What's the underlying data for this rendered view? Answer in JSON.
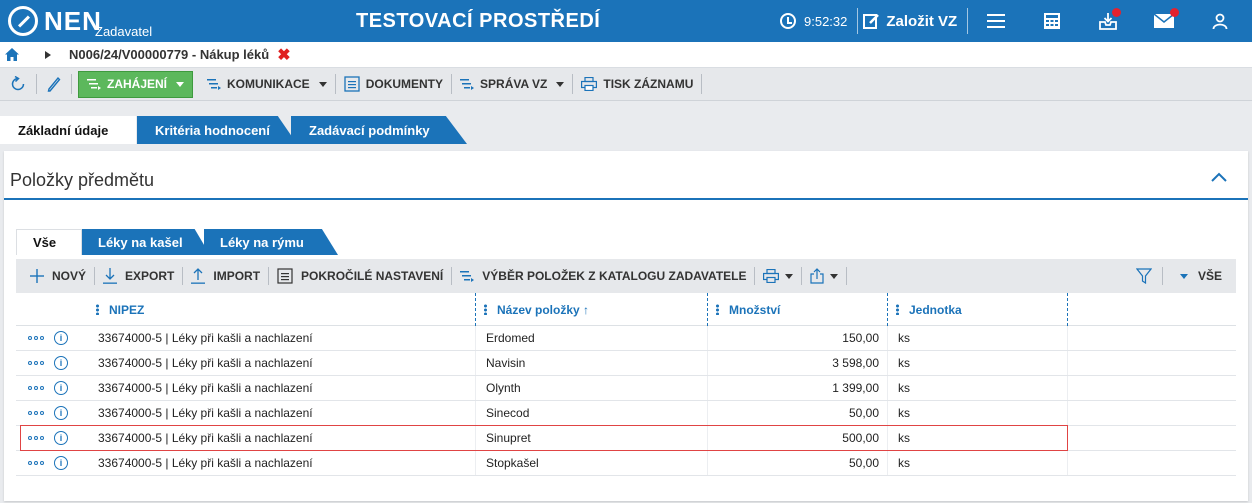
{
  "header": {
    "logo_text": "NEN",
    "logo_sub": "Zadavatel",
    "title": "TESTOVACÍ PROSTŘEDÍ",
    "time": "9:52:32",
    "create_label": "Založit VZ",
    "accent_color": "#1b73b9",
    "icons": [
      "menu-icon",
      "calculator-icon",
      "inbox-download-icon",
      "mail-icon",
      "user-icon"
    ]
  },
  "breadcrumb": {
    "text": "N006/24/V00000779 - Nákup léků",
    "close": "✖"
  },
  "toolbar": {
    "zahajeni": "ZAHÁJENÍ",
    "komunikace": "KOMUNIKACE",
    "dokumenty": "DOKUMENTY",
    "sprava_vz": "SPRÁVA VZ",
    "tisk": "TISK ZÁZNAMU"
  },
  "main_tabs": [
    {
      "label": "Základní údaje",
      "active": true
    },
    {
      "label": "Kritéria hodnocení",
      "active": false
    },
    {
      "label": "Zadávací podmínky",
      "active": false
    }
  ],
  "panel": {
    "title": "Položky předmětu",
    "subtabs": [
      {
        "label": "Vše",
        "active": true
      },
      {
        "label": "Léky na kašel",
        "active": false
      },
      {
        "label": "Léky na rýmu",
        "active": false
      }
    ],
    "grid_toolbar": {
      "novy": "NOVÝ",
      "export": "EXPORT",
      "import": "IMPORT",
      "pokrocile": "POKROČILÉ NASTAVENÍ",
      "vyber": "VÝBĚR POLOŽEK Z KATALOGU ZADAVATELE",
      "filter_value": "VŠE"
    },
    "columns": [
      "NIPEZ",
      "Název položky ↑",
      "Množství",
      "Jednotka"
    ],
    "rows": [
      {
        "nipez": "33674000-5 | Léky při kašli a nachlazení",
        "name": "Erdomed",
        "qty": "150,00",
        "unit": "ks"
      },
      {
        "nipez": "33674000-5 | Léky při kašli a nachlazení",
        "name": "Navisin",
        "qty": "3 598,00",
        "unit": "ks"
      },
      {
        "nipez": "33674000-5 | Léky při kašli a nachlazení",
        "name": "Olynth",
        "qty": "1 399,00",
        "unit": "ks"
      },
      {
        "nipez": "33674000-5 | Léky při kašli a nachlazení",
        "name": "Sinecod",
        "qty": "50,00",
        "unit": "ks"
      },
      {
        "nipez": "33674000-5 | Léky při kašli a nachlazení",
        "name": "Sinupret",
        "qty": "500,00",
        "unit": "ks"
      },
      {
        "nipez": "33674000-5 | Léky při kašli a nachlazení",
        "name": "Stopkašel",
        "qty": "50,00",
        "unit": "ks"
      }
    ]
  }
}
